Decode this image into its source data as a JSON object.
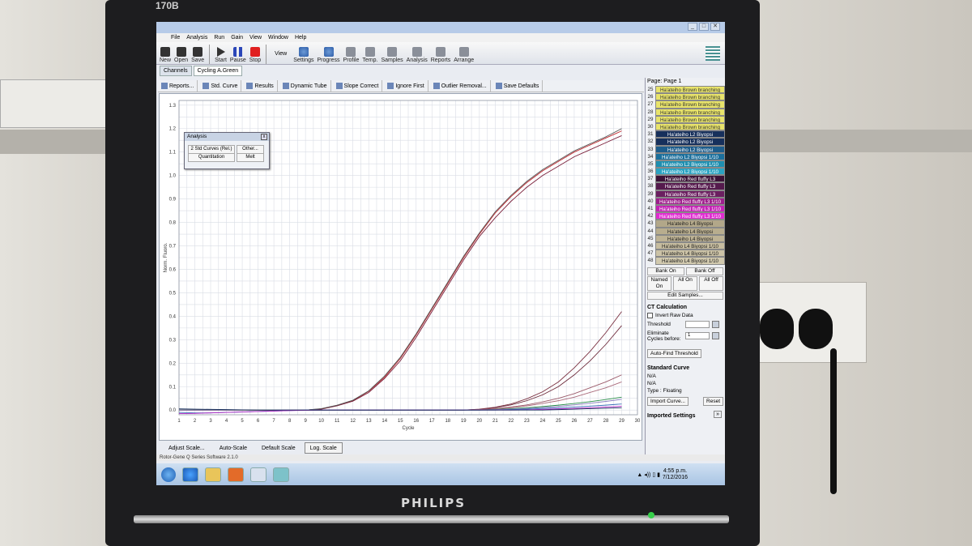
{
  "monitor": {
    "brand": "PHILIPS",
    "model": "170B"
  },
  "window": {
    "controls": [
      "_",
      "□",
      "✕"
    ]
  },
  "menu": [
    "File",
    "Analysis",
    "Run",
    "Gain",
    "View",
    "Window",
    "Help"
  ],
  "toolbar": {
    "buttons": [
      {
        "label": "New",
        "icon": "new-file-icon"
      },
      {
        "label": "Open",
        "icon": "open-folder-icon"
      },
      {
        "label": "Save",
        "icon": "save-disk-icon"
      },
      {
        "label": "Start",
        "icon": "play-icon"
      },
      {
        "label": "Pause",
        "icon": "pause-icon"
      },
      {
        "label": "Stop",
        "icon": "stop-icon"
      }
    ],
    "view_label": "View",
    "view_buttons": [
      {
        "label": "Settings",
        "icon": "settings-icon"
      },
      {
        "label": "Progress",
        "icon": "progress-icon"
      },
      {
        "label": "Profile",
        "icon": "profile-icon"
      },
      {
        "label": "Temp.",
        "icon": "temperature-icon"
      },
      {
        "label": "Samples",
        "icon": "samples-icon"
      },
      {
        "label": "Analysis",
        "icon": "analysis-icon"
      },
      {
        "label": "Reports",
        "icon": "reports-icon"
      },
      {
        "label": "Arrange",
        "icon": "arrange-icon"
      }
    ]
  },
  "tabs": {
    "channels": "Channels",
    "active": "Cycling A.Green"
  },
  "subtoolbar": [
    "Reports...",
    "Std. Curve",
    "Results",
    "Dynamic Tube",
    "Slope Correct",
    "Ignore First",
    "Outlier Removal...",
    "Save Defaults"
  ],
  "analysis_popup": {
    "title": "Analysis",
    "btn1": "2 Std Curves (Rel.)",
    "btn2": "Other...",
    "btn3": "Quantitation",
    "btn4": "Melt"
  },
  "bottom_buttons": [
    "Adjust Scale...",
    "Auto-Scale",
    "Default Scale",
    "Log. Scale"
  ],
  "status": "Rotor-Gene Q Series Software 2.1.0",
  "sidebar": {
    "page": "Page: Page 1",
    "samples": [
      {
        "n": "25",
        "name": "Ha'ateiho Brown branching",
        "bg": "#e8e36a",
        "fg": "#333"
      },
      {
        "n": "26",
        "name": "Ha'ateiho Brown branching",
        "bg": "#e8e36a",
        "fg": "#333"
      },
      {
        "n": "27",
        "name": "Ha'ateiho Brown branching",
        "bg": "#e8e36a",
        "fg": "#333"
      },
      {
        "n": "28",
        "name": "Ha'ateiho Brown branching",
        "bg": "#e8e36a",
        "fg": "#333"
      },
      {
        "n": "29",
        "name": "Ha'ateiho Brown branching",
        "bg": "#e8e36a",
        "fg": "#333"
      },
      {
        "n": "30",
        "name": "Ha'ateiho Brown branching",
        "bg": "#e8e36a",
        "fg": "#333"
      },
      {
        "n": "31",
        "name": "Ha'ateiho L2 Biyopsi",
        "bg": "#17305c",
        "fg": "#fff"
      },
      {
        "n": "32",
        "name": "Ha'ateiho L2 Biyopsi",
        "bg": "#17305c",
        "fg": "#fff"
      },
      {
        "n": "33",
        "name": "Ha'ateiho L2 Biyopsi",
        "bg": "#1d5d8c",
        "fg": "#fff"
      },
      {
        "n": "34",
        "name": "Ha'ateiho L2 Biyopsi 1/10",
        "bg": "#1b6f9c",
        "fg": "#fff"
      },
      {
        "n": "35",
        "name": "Ha'ateiho L2 Biyopsi 1/10",
        "bg": "#1f8fb0",
        "fg": "#fff"
      },
      {
        "n": "36",
        "name": "Ha'ateiho L2 Biyopsi 1/10",
        "bg": "#2aa3c2",
        "fg": "#fff"
      },
      {
        "n": "37",
        "name": "Ha'ateiho Red fluffy L3",
        "bg": "#3b1236",
        "fg": "#fff"
      },
      {
        "n": "38",
        "name": "Ha'ateiho Red fluffy L3",
        "bg": "#551a4d",
        "fg": "#fff"
      },
      {
        "n": "39",
        "name": "Ha'ateiho Red fluffy L3",
        "bg": "#6b1f60",
        "fg": "#fff"
      },
      {
        "n": "40",
        "name": "Ha'ateiho Red fluffy L3 1/10",
        "bg": "#9e1f8c",
        "fg": "#fff"
      },
      {
        "n": "41",
        "name": "Ha'ateiho Red fluffy L3 1/10",
        "bg": "#c422b5",
        "fg": "#fff"
      },
      {
        "n": "42",
        "name": "Ha'ateiho Red fluffy L3 1/10",
        "bg": "#e02bd0",
        "fg": "#fff"
      },
      {
        "n": "43",
        "name": "Ha'ateiho L4 Biyopsi",
        "bg": "#b2a789",
        "fg": "#222"
      },
      {
        "n": "44",
        "name": "Ha'ateiho L4 Biyopsi",
        "bg": "#b8ad8e",
        "fg": "#222"
      },
      {
        "n": "45",
        "name": "Ha'ateiho L4 Biyopsi",
        "bg": "#bdb294",
        "fg": "#222"
      },
      {
        "n": "46",
        "name": "Ha'ateiho L4 Biyopsi 1/10",
        "bg": "#c6bc9f",
        "fg": "#222"
      },
      {
        "n": "47",
        "name": "Ha'ateiho L4 Biyopsi 1/10",
        "bg": "#cbc2a6",
        "fg": "#222"
      },
      {
        "n": "48",
        "name": "Ha'ateiho L4 Biyopsi 1/10",
        "bg": "#d1c9ae",
        "fg": "#222"
      }
    ],
    "bank_on": "Bank On",
    "bank_off": "Bank Off",
    "named_on": "Named On",
    "all_on": "All On",
    "all_off": "All Off",
    "edit_samples": "Edit Samples...",
    "ct_title": "CT Calculation",
    "invert_raw": "Invert Raw Data",
    "threshold_label": "Threshold",
    "eliminate_label": "Eliminate Cycles before:",
    "eliminate_value": "1",
    "auto_find": "Auto-Find Threshold",
    "std_title": "Standard Curve",
    "na1": "N/A",
    "na2": "N/A",
    "type": "Type : Floating",
    "import_curve": "Import Curve...",
    "reset": "Reset",
    "imported": "Imported Settings"
  },
  "taskbar": {
    "time": "4:55 p.m.",
    "date": "7/12/2016"
  },
  "chart_data": {
    "type": "line",
    "xlabel": "Cycle",
    "ylabel": "Norm. Fluoro.",
    "xlim": [
      1,
      30
    ],
    "ylim": [
      -0.02,
      1.32
    ],
    "x_ticks": [
      "1",
      "2",
      "3",
      "4",
      "5",
      "6",
      "7",
      "8",
      "9",
      "10",
      "11",
      "12",
      "13",
      "14",
      "15",
      "16",
      "17",
      "18",
      "19",
      "20",
      "21",
      "22",
      "23",
      "24",
      "25",
      "26",
      "27",
      "28",
      "29",
      "30"
    ],
    "y_ticks": [
      "0.0",
      "0.1",
      "0.2",
      "0.3",
      "0.4",
      "0.5",
      "0.6",
      "0.7",
      "0.8",
      "0.9",
      "1.0",
      "1.1",
      "1.2",
      "1.3"
    ],
    "grid": true,
    "series": [
      {
        "color": "#c0272d",
        "values": [
          0,
          0,
          0,
          0,
          0,
          0,
          0,
          0,
          0,
          0.005,
          0.02,
          0.04,
          0.08,
          0.14,
          0.22,
          0.32,
          0.43,
          0.54,
          0.65,
          0.75,
          0.84,
          0.91,
          0.97,
          1.02,
          1.06,
          1.1,
          1.13,
          1.16,
          1.19
        ]
      },
      {
        "color": "#7a1f3a",
        "values": [
          0,
          0,
          0,
          0,
          0,
          0,
          0,
          0,
          0,
          0.004,
          0.018,
          0.038,
          0.075,
          0.135,
          0.21,
          0.31,
          0.42,
          0.53,
          0.64,
          0.74,
          0.82,
          0.89,
          0.95,
          1.0,
          1.04,
          1.08,
          1.11,
          1.14,
          1.17
        ]
      },
      {
        "color": "#555555",
        "values": [
          0,
          0,
          0,
          0,
          0,
          0,
          0,
          0,
          0,
          0.006,
          0.021,
          0.042,
          0.082,
          0.145,
          0.225,
          0.325,
          0.435,
          0.545,
          0.655,
          0.755,
          0.845,
          0.915,
          0.975,
          1.025,
          1.065,
          1.105,
          1.135,
          1.165,
          1.2
        ]
      },
      {
        "color": "#6d2a3a",
        "values": [
          0,
          0,
          0,
          0,
          0,
          0,
          0,
          0,
          0,
          0,
          0,
          0,
          0,
          0,
          0,
          0,
          0,
          0,
          0,
          0.003,
          0.01,
          0.022,
          0.04,
          0.065,
          0.1,
          0.15,
          0.21,
          0.28,
          0.36
        ]
      },
      {
        "color": "#7a3040",
        "values": [
          0,
          0,
          0,
          0,
          0,
          0,
          0,
          0,
          0,
          0,
          0,
          0,
          0,
          0,
          0,
          0,
          0,
          0,
          0,
          0.004,
          0.012,
          0.026,
          0.048,
          0.078,
          0.12,
          0.18,
          0.25,
          0.33,
          0.42
        ]
      },
      {
        "color": "#9b5a6a",
        "values": [
          0,
          0,
          0,
          0,
          0,
          0,
          0,
          0,
          0,
          0,
          0,
          0,
          0,
          0,
          0,
          0,
          0,
          0,
          0,
          0.002,
          0.006,
          0.013,
          0.022,
          0.035,
          0.05,
          0.07,
          0.095,
          0.12,
          0.15
        ]
      },
      {
        "color": "#aa6b7b",
        "values": [
          0,
          0,
          0,
          0,
          0,
          0,
          0,
          0,
          0,
          0,
          0,
          0,
          0,
          0,
          0,
          0,
          0,
          0,
          0,
          0.002,
          0.005,
          0.01,
          0.018,
          0.028,
          0.04,
          0.055,
          0.075,
          0.095,
          0.12
        ]
      },
      {
        "color": "#2a8f4a",
        "values": [
          0,
          0,
          0,
          0,
          0,
          0,
          0,
          0,
          0,
          0,
          0,
          0,
          0,
          0,
          0,
          0,
          0,
          0,
          0,
          0,
          0.003,
          0.006,
          0.01,
          0.015,
          0.021,
          0.028,
          0.036,
          0.045,
          0.055
        ]
      },
      {
        "color": "#8a7fbf",
        "values": [
          0,
          0,
          0,
          0,
          0,
          0,
          0,
          0,
          0,
          0,
          0,
          0,
          0,
          0,
          0,
          0,
          0,
          0,
          0,
          0,
          0.002,
          0.004,
          0.007,
          0.011,
          0.016,
          0.022,
          0.029,
          0.037,
          0.046
        ]
      },
      {
        "color": "#3a6fb8",
        "values": [
          -0.01,
          -0.012,
          -0.012,
          -0.01,
          -0.008,
          -0.006,
          -0.004,
          -0.002,
          0,
          0,
          0,
          0,
          0,
          0,
          0,
          0,
          0,
          0,
          0,
          0,
          0,
          0.002,
          0.004,
          0.007,
          0.01,
          0.013,
          0.017,
          0.021,
          0.026
        ]
      },
      {
        "color": "#b022c2",
        "values": [
          -0.015,
          -0.014,
          -0.012,
          -0.01,
          -0.008,
          -0.006,
          -0.004,
          -0.002,
          -0.001,
          0,
          0,
          0,
          0,
          0,
          0,
          0,
          0,
          0,
          0,
          0,
          0,
          0,
          0.001,
          0.003,
          0.005,
          0.007,
          0.01,
          0.013,
          0.016
        ]
      },
      {
        "color": "#17305c",
        "values": [
          0.005,
          0.004,
          0.003,
          0.002,
          0.001,
          0,
          0,
          0,
          0,
          0,
          0,
          0,
          0,
          0,
          0,
          0,
          0,
          0,
          0,
          0,
          0,
          0,
          0,
          0,
          0.002,
          0.004,
          0.006,
          0.008,
          0.01
        ]
      }
    ]
  }
}
